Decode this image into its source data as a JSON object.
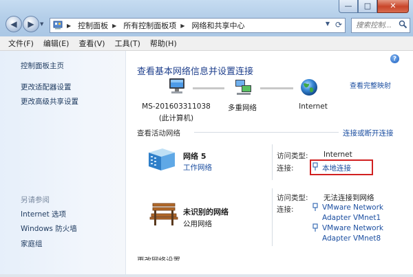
{
  "titlebar": {
    "min_glyph": "—",
    "max_glyph": "□",
    "close_glyph": "✕"
  },
  "address": {
    "crumbs": [
      "控制面板",
      "所有控制面板项",
      "网络和共享中心"
    ]
  },
  "search": {
    "placeholder": "搜索控制..."
  },
  "menu": [
    "文件(F)",
    "编辑(E)",
    "查看(V)",
    "工具(T)",
    "帮助(H)"
  ],
  "sidebar": {
    "home": "控制面板主页",
    "links": [
      "更改适配器设置",
      "更改高级共享设置"
    ],
    "see_also_title": "另请参阅",
    "see_also": [
      "Internet 选项",
      "Windows 防火墙",
      "家庭组"
    ]
  },
  "main": {
    "title": "查看基本网络信息并设置连接",
    "view_map": "查看完整映射",
    "map": {
      "computer_name": "MS-201603311038",
      "computer_sub": "(此计算机)",
      "middle": "多重网络",
      "internet": "Internet"
    },
    "active_title": "查看活动网络",
    "connect_link": "连接或断开连接",
    "networks": [
      {
        "name": "网络  5",
        "type": "工作网络",
        "access_label": "访问类型:",
        "access_value": "Internet",
        "conn_label": "连接:",
        "conn_items": [
          "本地连接"
        ]
      },
      {
        "name": "未识别的网络",
        "type": "公用网络",
        "access_label": "访问类型:",
        "access_value": "无法连接到网络",
        "conn_label": "连接:",
        "conn_items": [
          "VMware Network Adapter VMnet1",
          "VMware Network Adapter VMnet8"
        ],
        "conn_lines": [
          "VMware Network",
          "Adapter VMnet1",
          "VMware Network",
          "Adapter VMnet8"
        ]
      }
    ],
    "cut_heading": "更改网络设置"
  },
  "colors": {
    "link": "#1b4ea0",
    "title": "#1e3f8c",
    "highlight_box": "#d12020"
  }
}
